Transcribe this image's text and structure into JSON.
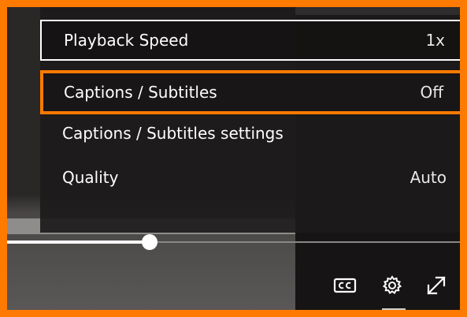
{
  "menu": {
    "items": [
      {
        "label": "Playback Speed",
        "value": "1x"
      },
      {
        "label": "Captions / Subtitles",
        "value": "Off"
      },
      {
        "label": "Captions / Subtitles settings",
        "value": ""
      },
      {
        "label": "Quality",
        "value": "Auto"
      }
    ]
  },
  "player": {
    "progress_fraction": 0.31
  },
  "controls": {
    "icons": [
      "closed-captions-icon",
      "gear-icon",
      "fullscreen-icon"
    ]
  },
  "colors": {
    "highlight_border": "#ff7a00",
    "menu_background": "#1c1a1a",
    "text": "#ffffff"
  }
}
